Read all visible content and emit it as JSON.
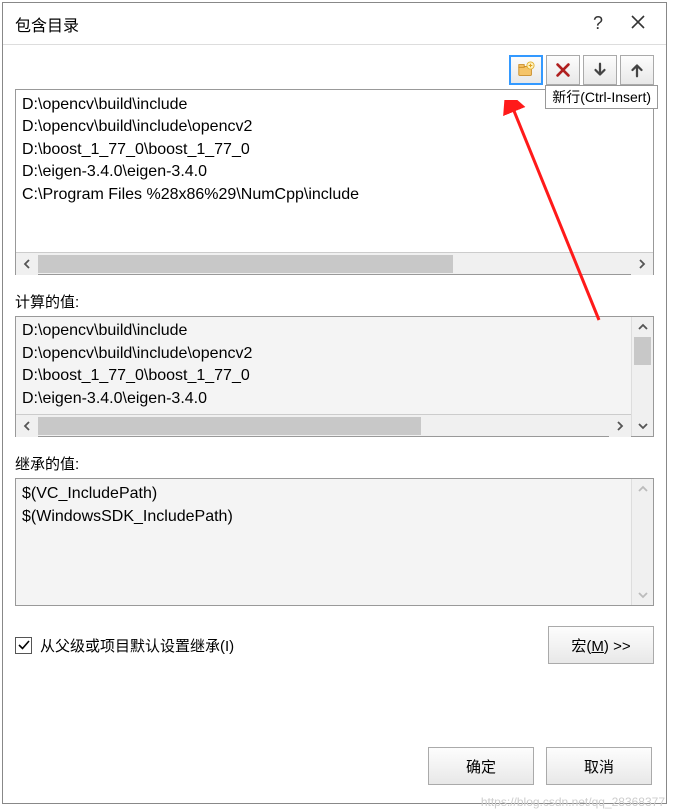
{
  "dialog": {
    "title": "包含目录",
    "help_symbol": "?",
    "tooltip_newline": "新行(Ctrl-Insert)"
  },
  "toolbar": {
    "new_icon": "folder-new-icon",
    "delete_icon": "delete-x-icon",
    "down_icon": "arrow-down-icon",
    "up_icon": "arrow-up-icon"
  },
  "entries": [
    "D:\\opencv\\build\\include",
    "D:\\opencv\\build\\include\\opencv2",
    "D:\\boost_1_77_0\\boost_1_77_0",
    "D:\\eigen-3.4.0\\eigen-3.4.0",
    "C:\\Program Files %28x86%29\\NumCpp\\include"
  ],
  "labels": {
    "computed": "计算的值:",
    "inherited": "继承的值:",
    "inherit_checkbox": "从父级或项目默认设置继承(I)"
  },
  "computed_entries": [
    "D:\\opencv\\build\\include",
    "D:\\opencv\\build\\include\\opencv2",
    "D:\\boost_1_77_0\\boost_1_77_0",
    "D:\\eigen-3.4.0\\eigen-3.4.0"
  ],
  "inherited_entries": [
    "$(VC_IncludePath)",
    "$(WindowsSDK_IncludePath)"
  ],
  "buttons": {
    "macro": "宏(M) >>",
    "ok": "确定",
    "cancel": "取消"
  },
  "inherit_checked": true,
  "watermark": "https://blog.csdn.net/qq_28368377"
}
